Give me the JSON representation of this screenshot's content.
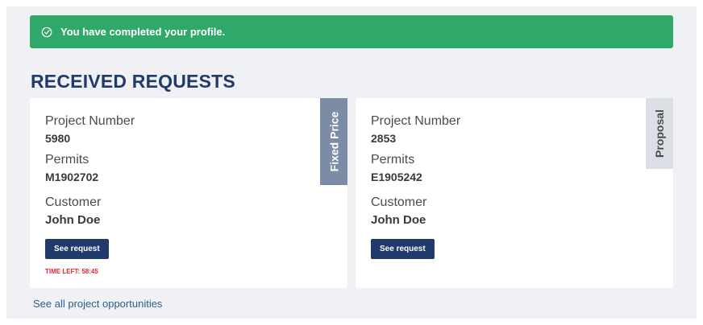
{
  "alert": {
    "text": "You have completed your profile.",
    "icon": "check-circle-icon"
  },
  "section": {
    "title": "RECEIVED REQUESTS"
  },
  "cards": [
    {
      "tag": "Fixed Price",
      "project_label": "Project Number",
      "project_value": "5980",
      "permits_label": "Permits",
      "permits_value": "M1902702",
      "customer_label": "Customer",
      "customer_value": "John Doe",
      "button_label": "See request",
      "time_left": "TIME LEFT: 58:45"
    },
    {
      "tag": "Proposal",
      "project_label": "Project Number",
      "project_value": "2853",
      "permits_label": "Permits",
      "permits_value": "E1905242",
      "customer_label": "Customer",
      "customer_value": "John Doe",
      "button_label": "See request"
    }
  ],
  "footer": {
    "link_text": "See all project opportunities"
  },
  "colors": {
    "success": "#2fa86a",
    "primary": "#1f3a6b",
    "danger": "#e0263b",
    "tag_fixed": "#7c8ba6",
    "tag_proposal": "#dcdfe5"
  }
}
